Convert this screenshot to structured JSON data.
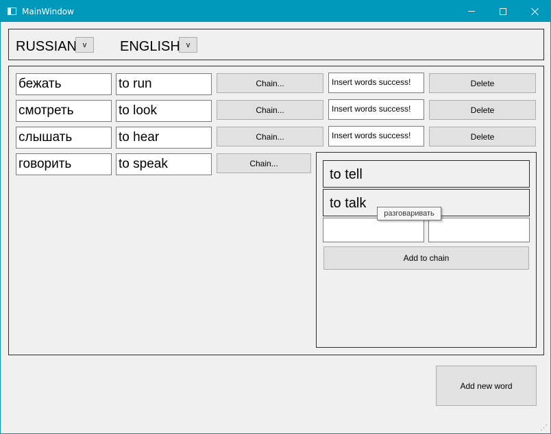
{
  "window": {
    "title": "MainWindow"
  },
  "languages": {
    "source": "RUSSIAN",
    "target": "ENGLISH",
    "dropdown_label": "v"
  },
  "rows": [
    {
      "russian": "бежать",
      "english": "to run",
      "chain_label": "Chain...",
      "status": "Insert words success!",
      "delete_label": "Delete"
    },
    {
      "russian": "смотреть",
      "english": "to look",
      "chain_label": "Chain...",
      "status": "Insert words success!",
      "delete_label": "Delete"
    },
    {
      "russian": "слышать",
      "english": "to hear",
      "chain_label": "Chain...",
      "status": "Insert words success!",
      "delete_label": "Delete"
    },
    {
      "russian": "говорить",
      "english": "to speak",
      "chain_label": "Chain..."
    }
  ],
  "chain": {
    "items": [
      "to tell",
      "to talk"
    ],
    "input_left": "",
    "input_right": "",
    "add_label": "Add to chain"
  },
  "tooltip": "разговаривать",
  "add_new_word_label": "Add new word"
}
